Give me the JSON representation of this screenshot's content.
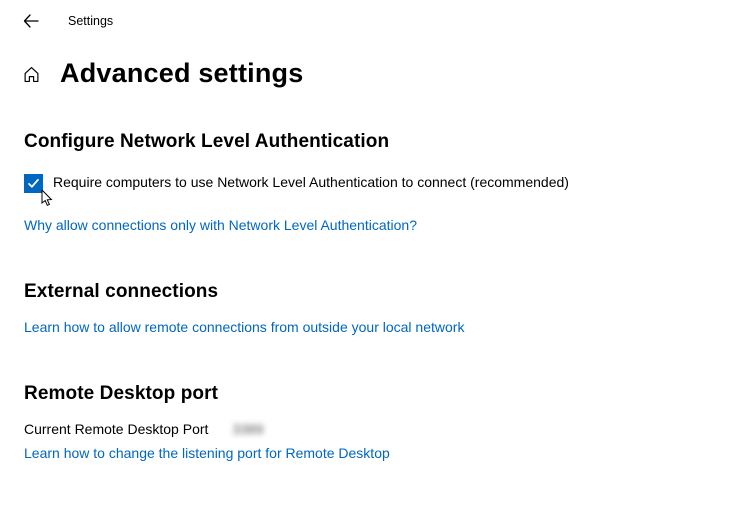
{
  "app_title": "Settings",
  "page_title": "Advanced settings",
  "section1": {
    "heading": "Configure Network Level Authentication",
    "checkbox_label": "Require computers to use Network Level Authentication to connect (recommended)",
    "link": "Why allow connections only with Network Level Authentication?"
  },
  "section2": {
    "heading": "External connections",
    "link": "Learn how to allow remote connections from outside your local network"
  },
  "section3": {
    "heading": "Remote Desktop port",
    "port_label": "Current Remote Desktop Port",
    "port_value": "3389",
    "link": "Learn how to change the listening port for Remote Desktop"
  }
}
